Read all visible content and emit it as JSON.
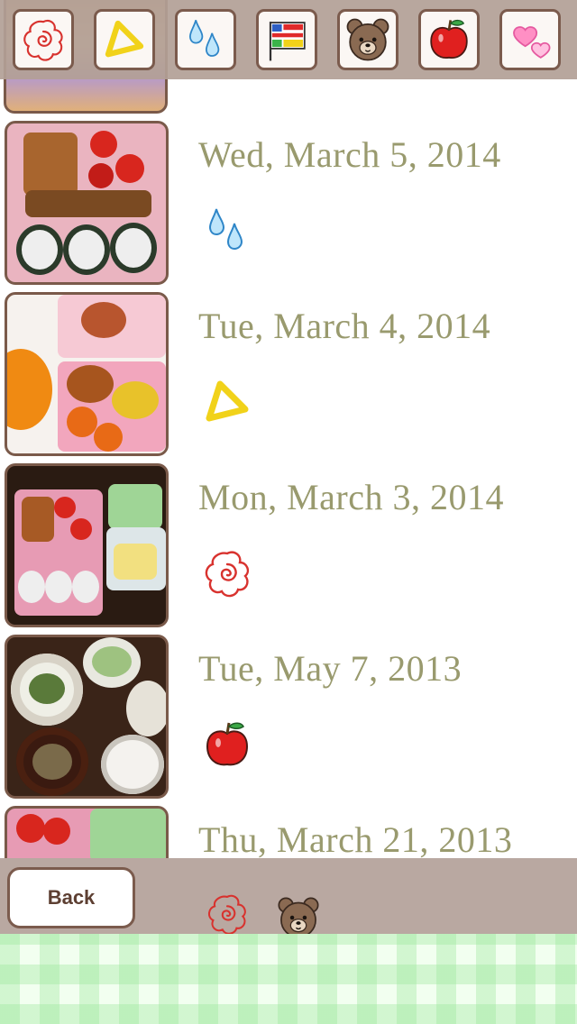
{
  "toolbar": {
    "icons": [
      "flower-stamp",
      "triangle-stamp",
      "raindrops-stamp",
      "flag-stamp",
      "bear-stamp",
      "apple-stamp",
      "hearts-stamp"
    ]
  },
  "entries": [
    {
      "date": "Wed, March 5, 2014",
      "stamp": "raindrops-stamp"
    },
    {
      "date": "Tue, March 4, 2014",
      "stamp": "triangle-stamp"
    },
    {
      "date": "Mon, March 3, 2014",
      "stamp": "flower-stamp"
    },
    {
      "date": "Tue, May 7, 2013",
      "stamp": "apple-stamp"
    },
    {
      "date": "Thu, March 21, 2013",
      "stamps": [
        "flower-stamp",
        "bear-stamp"
      ]
    }
  ],
  "bottom": {
    "back_label": "Back"
  },
  "colors": {
    "date_text": "#999a6e",
    "border_brown": "#7b5b4d",
    "toolbar_bg": "#b2a096",
    "bottom_bar_bg": "#b9a8a1"
  }
}
